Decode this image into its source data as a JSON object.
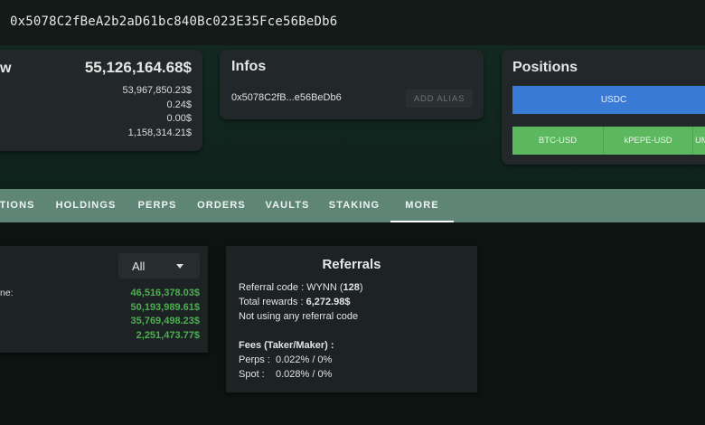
{
  "wallet": {
    "address": "0x5078C2fBeA2b2aD61bc840Bc023E35Fce56BeDb6"
  },
  "overview": {
    "title": "w",
    "total": "55,126,164.68$",
    "rows": [
      "53,967,850.23$",
      "0.24$",
      "0.00$",
      "1,158,314.21$"
    ]
  },
  "infos": {
    "title": "Infos",
    "address_short": "0x5078C2fB...e56BeDb6",
    "add_alias_label": "ADD ALIAS"
  },
  "positions": {
    "title": "Positions",
    "spot": [
      "USDC"
    ],
    "perps": [
      "BTC-USD",
      "kPEPE-USD",
      "UM"
    ]
  },
  "tabs": [
    "TIONS",
    "HOLDINGS",
    "PERPS",
    "ORDERS",
    "VAULTS",
    "STAKING",
    "MORE"
  ],
  "active_tab": "MORE",
  "volume": {
    "filter": "All",
    "label": "ne:",
    "values": [
      "46,516,378.03$",
      "50,193,989.61$",
      "35,769,498.23$",
      "2,251,473.77$"
    ]
  },
  "referrals": {
    "title": "Referrals",
    "code_label": "Referral code : WYNN (",
    "code_count": "128",
    "code_close": ")",
    "rewards_label": "Total rewards : ",
    "rewards_value": "6,272.98$",
    "using": "Not using any referral code",
    "fees_title": "Fees (Taker/Maker) :",
    "perps_fee": "Perps :  0.022% / 0%",
    "spot_fee": "Spot :    0.028% / 0%"
  },
  "colors": {
    "accent_blue": "#3a7bd5",
    "accent_green": "#5bb85e",
    "tab_bar": "#5e8576",
    "positive": "#4caf50"
  }
}
